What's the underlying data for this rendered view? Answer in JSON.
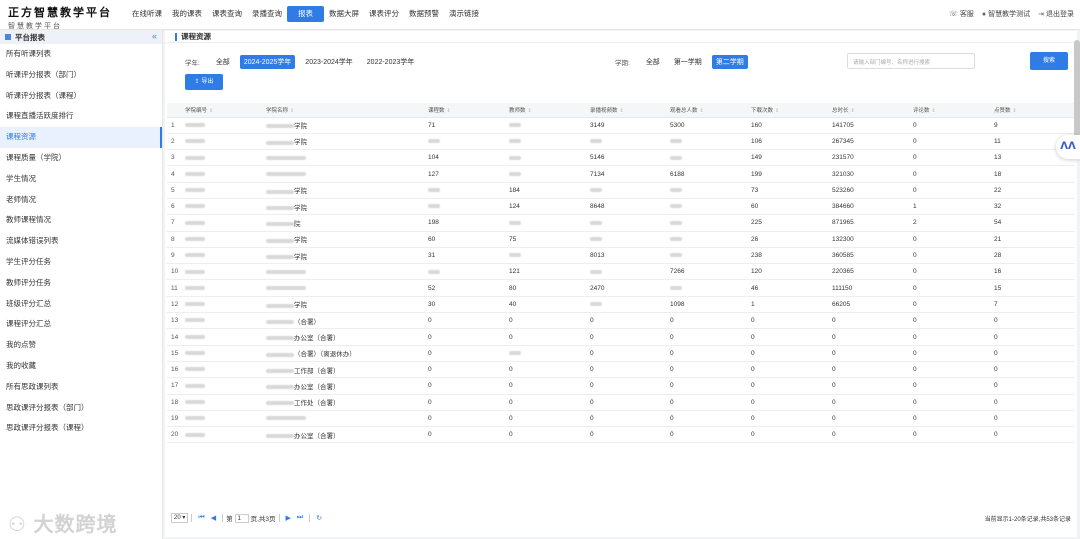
{
  "app": {
    "title": "正方智慧教学平台",
    "subtitle": "智慧教学平台"
  },
  "nav": [
    "在线听课",
    "我的课表",
    "课表查询",
    "录播查询",
    "报表",
    "数据大屏",
    "课表评分",
    "数据预警",
    "演示链接"
  ],
  "nav_active": 4,
  "top_right": {
    "service": "客服",
    "user": "智慧教学测试",
    "logout": "退出登录"
  },
  "sidebar": {
    "header": "平台报表",
    "collapse_icon": "«",
    "items": [
      "所有听课列表",
      "听课评分报表（部门）",
      "听课评分报表（课程）",
      "课程直播活跃度排行",
      "课程资源",
      "课程质量（学院）",
      "学生情况",
      "老师情况",
      "教师课程情况",
      "流媒体错误列表",
      "学生评分任务",
      "教师评分任务",
      "班级评分汇总",
      "课程评分汇总",
      "我的点赞",
      "我的收藏",
      "所有思政课列表",
      "思政课评分报表（部门）",
      "思政课评分报表（课程）"
    ],
    "active_index": 4
  },
  "page": {
    "breadcrumb": "课程资源"
  },
  "filters": {
    "year_label": "学年:",
    "years": [
      "全部",
      "2024-2025学年",
      "2023-2024学年",
      "2022-2023学年"
    ],
    "year_selected": 1,
    "term_label": "学期:",
    "terms": [
      "全部",
      "第一学期",
      "第二学期"
    ],
    "term_selected": 2,
    "search_placeholder": "请输入部门编号、名称进行搜索",
    "search_button": "搜索",
    "export_button": "导出"
  },
  "table": {
    "columns": [
      "学院编号",
      "学院名称",
      "课程数",
      "教师数",
      "录播视频数",
      "观看总人数",
      "下载次数",
      "总时长",
      "评论数",
      "点赞数"
    ],
    "rows": [
      {
        "n": "1",
        "name": "学院",
        "courses": "71",
        "teachers": "",
        "videos": "3149",
        "viewers": "5300",
        "downloads": "160",
        "duration": "141705",
        "comments": "0",
        "likes": "9"
      },
      {
        "n": "2",
        "name": "学院",
        "courses": "",
        "teachers": "",
        "videos": "",
        "viewers": "",
        "downloads": "106",
        "duration": "267345",
        "comments": "0",
        "likes": "11"
      },
      {
        "n": "3",
        "name": "",
        "courses": "104",
        "teachers": "",
        "videos": "5146",
        "viewers": "",
        "downloads": "149",
        "duration": "231570",
        "comments": "0",
        "likes": "13"
      },
      {
        "n": "4",
        "name": "",
        "courses": "127",
        "teachers": "",
        "videos": "7134",
        "viewers": "6188",
        "downloads": "199",
        "duration": "321030",
        "comments": "0",
        "likes": "18"
      },
      {
        "n": "5",
        "name": "学院",
        "courses": "",
        "teachers": "184",
        "videos": "",
        "viewers": "",
        "downloads": "73",
        "duration": "523260",
        "comments": "0",
        "likes": "22"
      },
      {
        "n": "6",
        "name": "学院",
        "courses": "",
        "teachers": "124",
        "videos": "8648",
        "viewers": "",
        "downloads": "60",
        "duration": "384660",
        "comments": "1",
        "likes": "32"
      },
      {
        "n": "7",
        "name": "院",
        "courses": "198",
        "teachers": "",
        "videos": "",
        "viewers": "",
        "downloads": "225",
        "duration": "871965",
        "comments": "2",
        "likes": "54"
      },
      {
        "n": "8",
        "name": "学院",
        "courses": "60",
        "teachers": "75",
        "videos": "",
        "viewers": "",
        "downloads": "26",
        "duration": "132300",
        "comments": "0",
        "likes": "21"
      },
      {
        "n": "9",
        "name": "学院",
        "courses": "31",
        "teachers": "",
        "videos": "8013",
        "viewers": "",
        "downloads": "238",
        "duration": "360585",
        "comments": "0",
        "likes": "28"
      },
      {
        "n": "10",
        "name": "",
        "courses": "",
        "teachers": "121",
        "videos": "",
        "viewers": "7266",
        "downloads": "120",
        "duration": "220365",
        "comments": "0",
        "likes": "16"
      },
      {
        "n": "11",
        "name": "",
        "courses": "52",
        "teachers": "80",
        "videos": "2470",
        "viewers": "",
        "downloads": "46",
        "duration": "111150",
        "comments": "0",
        "likes": "15"
      },
      {
        "n": "12",
        "name": "学院",
        "courses": "30",
        "teachers": "40",
        "videos": "",
        "viewers": "1098",
        "downloads": "1",
        "duration": "66205",
        "comments": "0",
        "likes": "7"
      },
      {
        "n": "13",
        "name": "（合署）",
        "courses": "0",
        "teachers": "0",
        "videos": "0",
        "viewers": "0",
        "downloads": "0",
        "duration": "0",
        "comments": "0",
        "likes": "0"
      },
      {
        "n": "14",
        "name": "办公室（合署）",
        "courses": "0",
        "teachers": "0",
        "videos": "0",
        "viewers": "0",
        "downloads": "0",
        "duration": "0",
        "comments": "0",
        "likes": "0"
      },
      {
        "n": "15",
        "name": "（合署）（离退休办）",
        "courses": "0",
        "teachers": "",
        "videos": "0",
        "viewers": "0",
        "downloads": "0",
        "duration": "0",
        "comments": "0",
        "likes": "0"
      },
      {
        "n": "16",
        "name": "工作部（合署）",
        "courses": "0",
        "teachers": "0",
        "videos": "0",
        "viewers": "0",
        "downloads": "0",
        "duration": "0",
        "comments": "0",
        "likes": "0"
      },
      {
        "n": "17",
        "name": "办公室（合署）",
        "courses": "0",
        "teachers": "0",
        "videos": "0",
        "viewers": "0",
        "downloads": "0",
        "duration": "0",
        "comments": "0",
        "likes": "0"
      },
      {
        "n": "18",
        "name": "工作处（合署）",
        "courses": "0",
        "teachers": "0",
        "videos": "0",
        "viewers": "0",
        "downloads": "0",
        "duration": "0",
        "comments": "0",
        "likes": "0"
      },
      {
        "n": "19",
        "name": "",
        "courses": "0",
        "teachers": "0",
        "videos": "0",
        "viewers": "0",
        "downloads": "0",
        "duration": "0",
        "comments": "0",
        "likes": "0"
      },
      {
        "n": "20",
        "name": "办公室（合署）",
        "courses": "0",
        "teachers": "0",
        "videos": "0",
        "viewers": "0",
        "downloads": "0",
        "duration": "0",
        "comments": "0",
        "likes": "0"
      }
    ]
  },
  "pager": {
    "page_size": "20",
    "page_label_prefix": "第",
    "current_page": "1",
    "page_label_suffix": "页,共3页",
    "summary": "当前显示1-20条记录,共53条记录"
  },
  "watermark": "大数跨境",
  "colors": {
    "accent": "#2f7ce6"
  }
}
